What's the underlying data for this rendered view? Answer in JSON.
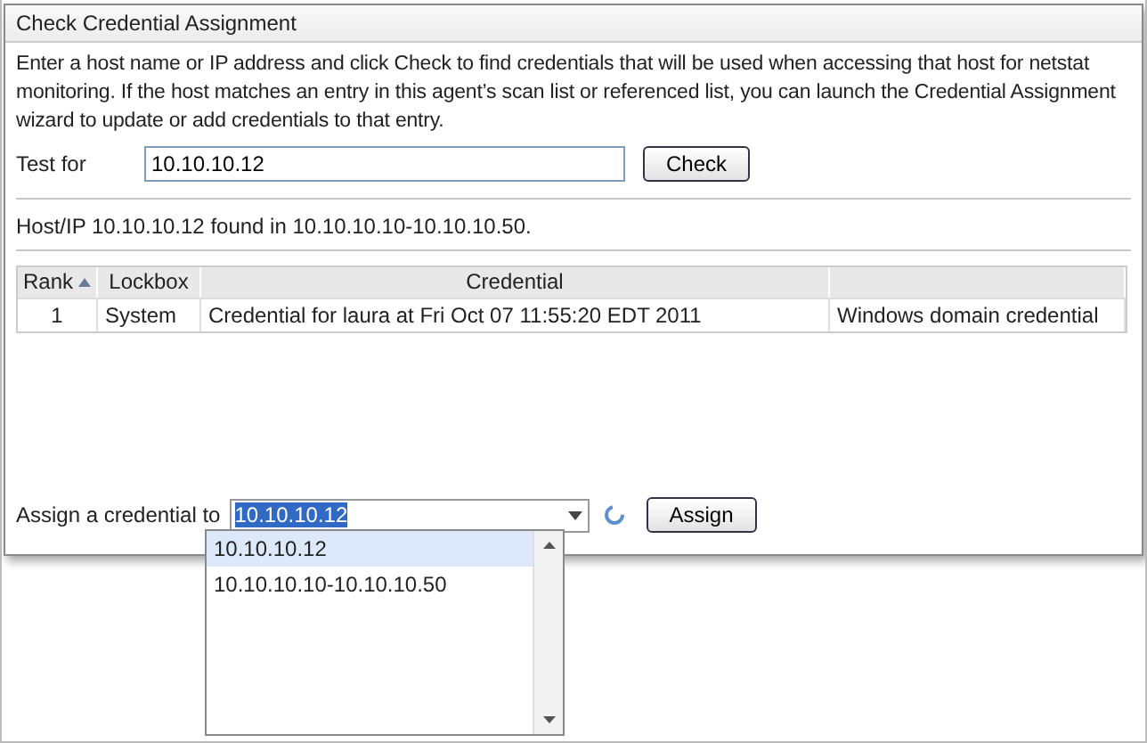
{
  "window": {
    "title": "Check Credential Assignment"
  },
  "description": "Enter a host name or IP address and click Check to find credentials that will be used when accessing that host for netstat monitoring. If the host matches an entry in this agent’s scan list or referenced list, you can launch the Credential Assignment wizard to update or add credentials to that entry.",
  "test": {
    "label": "Test for",
    "value": "10.10.10.12",
    "button": "Check"
  },
  "result": "Host/IP 10.10.10.12 found in 10.10.10.10-10.10.10.50.",
  "table": {
    "columns": [
      {
        "label": "Rank",
        "sorted": true
      },
      {
        "label": "Lockbox",
        "sorted": false
      },
      {
        "label": "Credential",
        "sorted": false
      },
      {
        "sorted": false
      }
    ],
    "rows": [
      {
        "cells": [
          "1",
          "System",
          "Credential for laura at Fri Oct 07 11:55:20 EDT 2011",
          "Windows domain credential"
        ]
      }
    ]
  },
  "assign": {
    "label": "Assign a credential to",
    "value": "10.10.10.12",
    "button": "Assign",
    "expanded": true,
    "options": [
      {
        "label": "10.10.10.12",
        "selected": true
      },
      {
        "label": "10.10.10.10-10.10.10.50",
        "selected": false
      }
    ]
  }
}
